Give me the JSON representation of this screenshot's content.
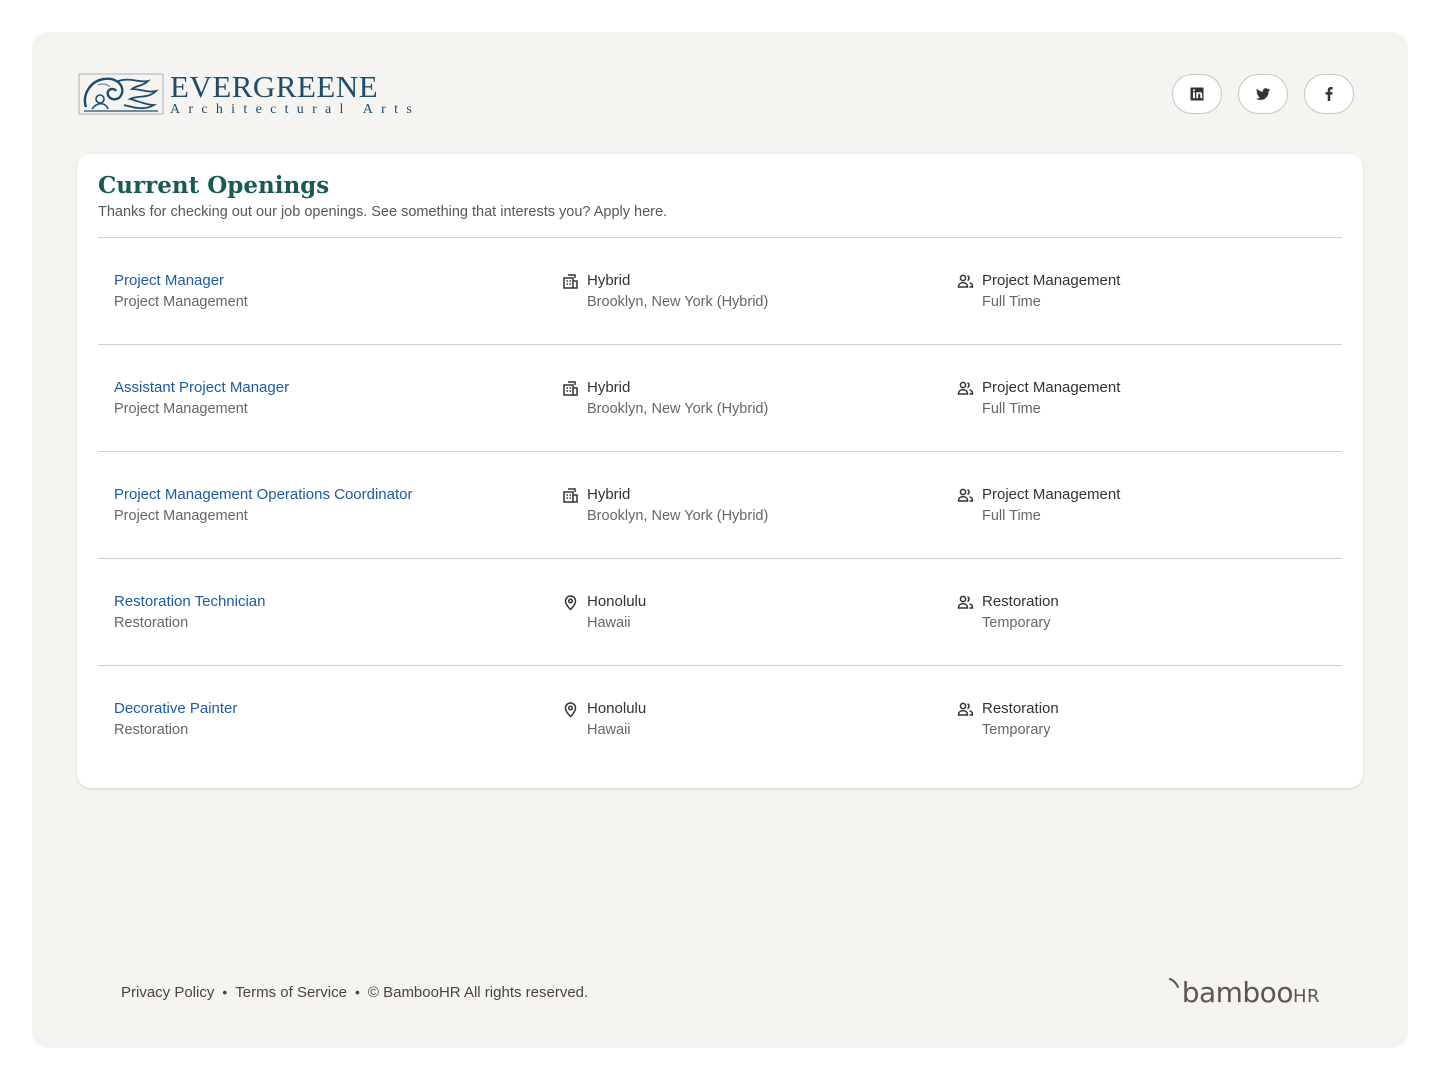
{
  "brand": {
    "name": "EVERGREENE",
    "subtitle": "Architectural Arts"
  },
  "social": [
    {
      "name": "linkedin-icon"
    },
    {
      "name": "twitter-icon"
    },
    {
      "name": "facebook-icon"
    }
  ],
  "openings": {
    "title": "Current Openings",
    "subtitle": "Thanks for checking out our job openings. See something that interests you? Apply here.",
    "jobs": [
      {
        "title": "Project Manager",
        "department": "Project Management",
        "location_type": "Hybrid",
        "location": "Brooklyn, New York (Hybrid)",
        "location_icon": "building-icon",
        "team": "Project Management",
        "employment": "Full Time"
      },
      {
        "title": "Assistant Project Manager",
        "department": "Project Management",
        "location_type": "Hybrid",
        "location": "Brooklyn, New York (Hybrid)",
        "location_icon": "building-icon",
        "team": "Project Management",
        "employment": "Full Time"
      },
      {
        "title": "Project Management Operations Coordinator",
        "department": "Project Management",
        "location_type": "Hybrid",
        "location": "Brooklyn, New York (Hybrid)",
        "location_icon": "building-icon",
        "team": "Project Management",
        "employment": "Full Time"
      },
      {
        "title": "Restoration Technician",
        "department": "Restoration",
        "location_type": "Honolulu",
        "location": "Hawaii",
        "location_icon": "map-pin-icon",
        "team": "Restoration",
        "employment": "Temporary"
      },
      {
        "title": "Decorative Painter",
        "department": "Restoration",
        "location_type": "Honolulu",
        "location": "Hawaii",
        "location_icon": "map-pin-icon",
        "team": "Restoration",
        "employment": "Temporary"
      }
    ]
  },
  "footer": {
    "privacy": "Privacy Policy",
    "terms": "Terms of Service",
    "separator": "•",
    "copyright": "© BambooHR All rights reserved.",
    "powered_by_main": "bamboo",
    "powered_by_suffix": "HR"
  },
  "colors": {
    "accent": "#1d5aa8",
    "heading": "#1a5a52",
    "brand": "#1e4d6b",
    "background": "#f5f4f1"
  }
}
